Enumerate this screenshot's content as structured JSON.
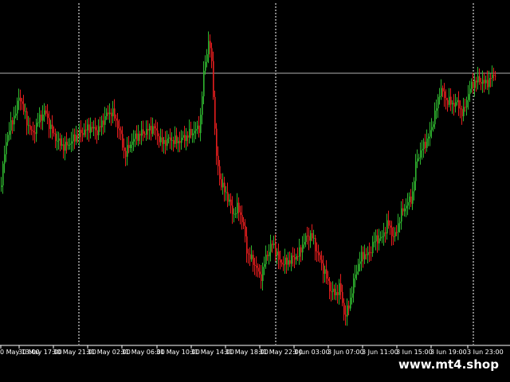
{
  "watermark": "www.mt4.shop",
  "colors": {
    "background": "#000000",
    "bull": "#2fb52f",
    "bear": "#e51e1e",
    "separator": "#ffffff",
    "level": "#b0b0b0"
  },
  "time_axis": [
    "0 May 13:00",
    "30 May 17:00",
    "30 May 21:00",
    "31 May 02:00",
    "31 May 06:00",
    "31 May 10:00",
    "31 May 14:00",
    "31 May 18:00",
    "31 May 22:00",
    "3 Jun 03:00",
    "3 Jun 07:00",
    "3 Jun 11:00",
    "3 Jun 15:00",
    "3 Jun 19:00",
    "3 Jun 23:00"
  ]
}
